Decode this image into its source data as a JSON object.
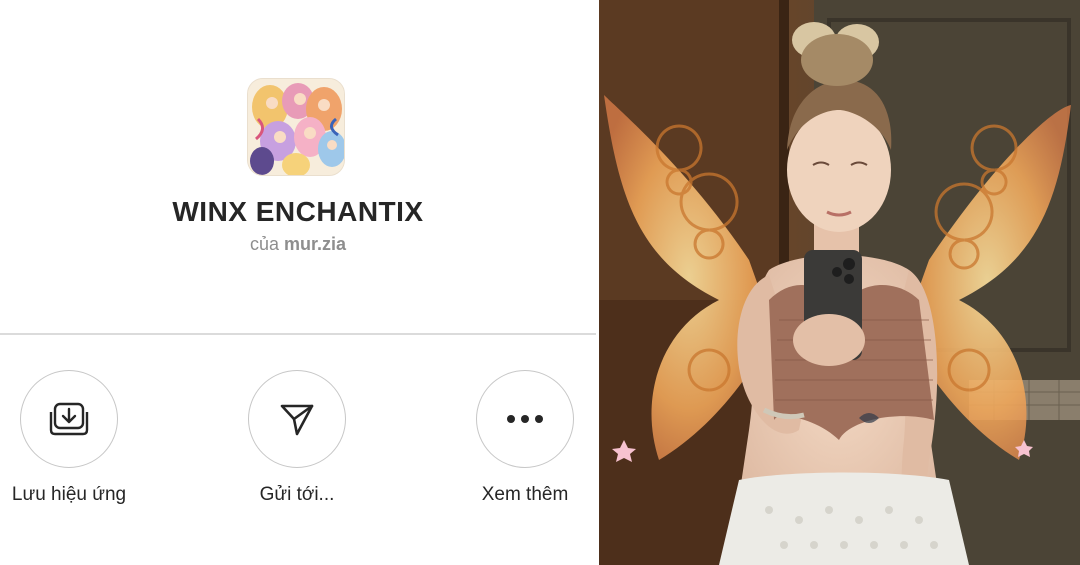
{
  "effect": {
    "title": "WINX ENCHANTIX",
    "author_prefix": "của",
    "author_name": "mur.zia",
    "thumbnail_icon": "winx-fairies-thumbnail"
  },
  "actions": [
    {
      "label": "Lưu hiệu ứng",
      "icon": "save-download-icon"
    },
    {
      "label": "Gửi tới...",
      "icon": "send-paper-plane-icon"
    },
    {
      "label": "Xem thêm",
      "icon": "more-dots-icon"
    }
  ],
  "photo": {
    "subject": "effect-preview-photo"
  },
  "colors": {
    "text_primary": "#262626",
    "text_secondary": "#8e8e8e",
    "divider": "#dbdbdb",
    "button_border": "#c7c7c7"
  }
}
